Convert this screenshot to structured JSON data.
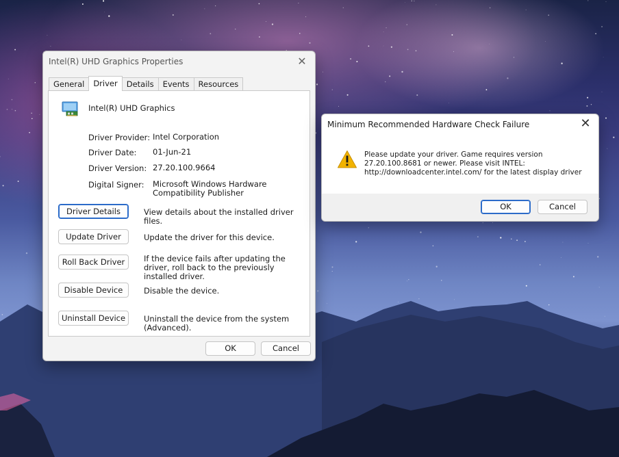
{
  "properties_dialog": {
    "title": "Intel(R) UHD Graphics Properties",
    "tabs": [
      "General",
      "Driver",
      "Details",
      "Events",
      "Resources"
    ],
    "active_tab": "Driver",
    "device_name": "Intel(R) UHD Graphics",
    "properties": [
      {
        "label": "Driver Provider:",
        "value": "Intel Corporation"
      },
      {
        "label": "Driver Date:",
        "value": "01-Jun-21"
      },
      {
        "label": "Driver Version:",
        "value": "27.20.100.9664"
      },
      {
        "label": "Digital Signer:",
        "value": "Microsoft Windows Hardware Compatibility Publisher"
      }
    ],
    "actions": [
      {
        "label": "Driver Details",
        "description": "View details about the installed driver files."
      },
      {
        "label": "Update Driver",
        "description": "Update the driver for this device."
      },
      {
        "label": "Roll Back Driver",
        "description": "If the device fails after updating the driver, roll back to the previously installed driver."
      },
      {
        "label": "Disable Device",
        "description": "Disable the device."
      },
      {
        "label": "Uninstall Device",
        "description": "Uninstall the device from the system (Advanced)."
      }
    ],
    "ok_label": "OK",
    "cancel_label": "Cancel",
    "icons": {
      "close": "close-icon",
      "device": "display-adapter-icon"
    }
  },
  "alert_dialog": {
    "title": "Minimum Recommended Hardware Check Failure",
    "message": "Please update your driver.  Game requires version\n27.20.100.8681 or newer. Please visit INTEL:\nhttp://downloadcenter.intel.com/ for the latest display driver",
    "ok_label": "OK",
    "cancel_label": "Cancel",
    "icons": {
      "close": "close-icon",
      "warning": "warning-icon"
    },
    "accent_color": "#2b6bc9",
    "warning_color": "#f2b300"
  }
}
